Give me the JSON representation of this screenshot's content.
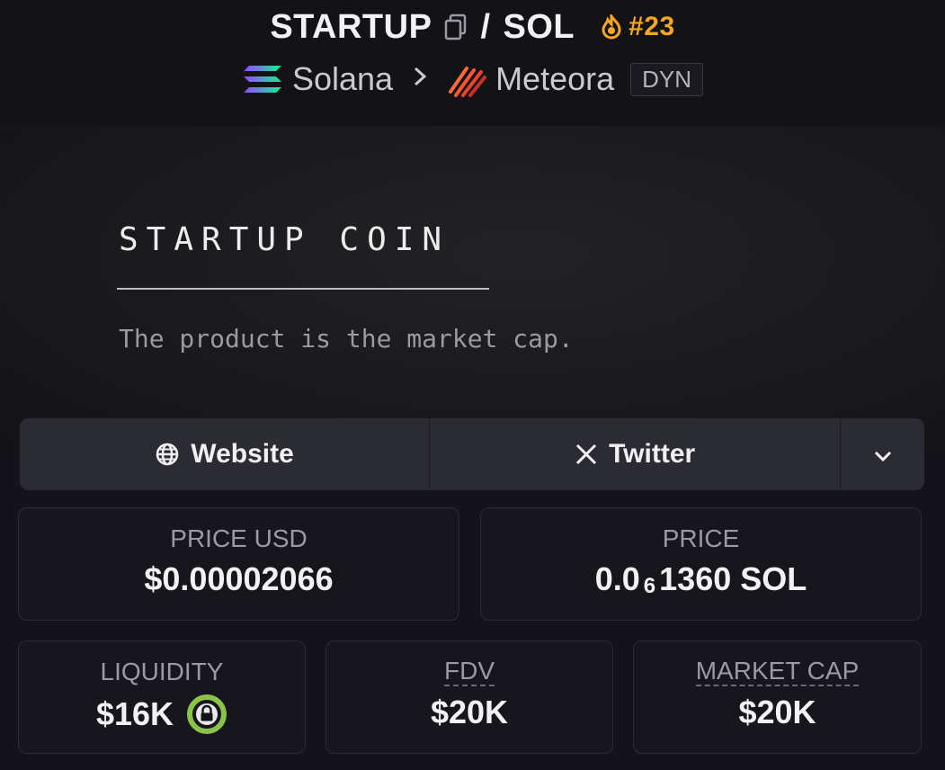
{
  "header": {
    "token_symbol": "STARTUP",
    "separator": "/",
    "quote_symbol": "SOL",
    "rank": "#23",
    "chain": "Solana",
    "dex": "Meteora",
    "pool_tag": "DYN"
  },
  "banner": {
    "name": "STARTUP COIN",
    "tagline": "The product is the market cap."
  },
  "links": {
    "website": "Website",
    "twitter": "Twitter"
  },
  "stats": {
    "price_usd_label": "PRICE USD",
    "price_usd_value": "$0.00002066",
    "price_label": "PRICE",
    "price_prefix": "0.0",
    "price_sub": "6",
    "price_suffix": "1360 SOL",
    "liquidity_label": "LIQUIDITY",
    "liquidity_value": "$16K",
    "fdv_label": "FDV",
    "fdv_value": "$20K",
    "mcap_label": "MARKET CAP",
    "mcap_value": "$20K"
  },
  "colors": {
    "accent_orange": "#f5a623",
    "lock_green": "#8bc34a"
  }
}
